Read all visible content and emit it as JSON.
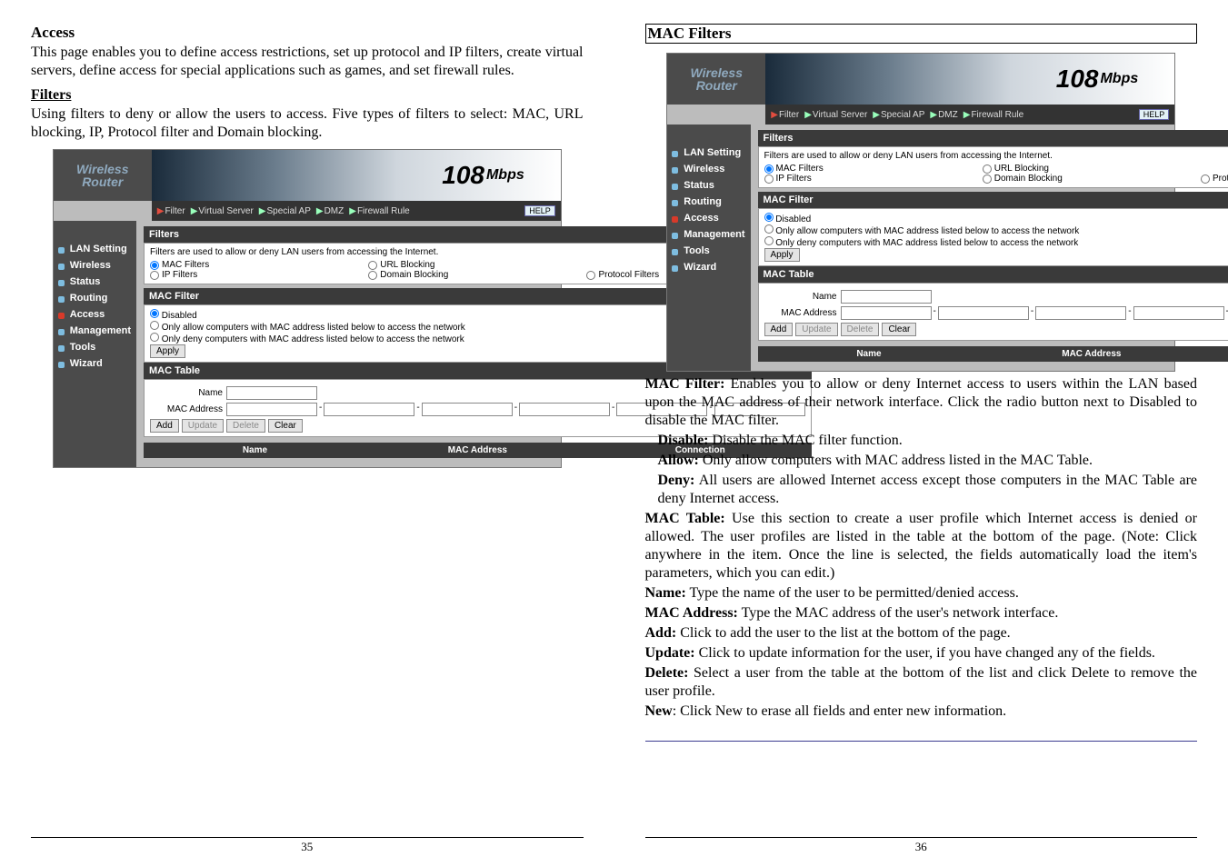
{
  "left": {
    "heading_access": "Access",
    "access_para": "This page enables you to define access restrictions, set up protocol and IP filters, create virtual servers, define access for special applications such as games, and set firewall rules.",
    "heading_filters": "Filters",
    "filters_para": "Using filters to deny or allow the users to access.  Five types of filters to select: MAC, URL blocking, IP, Protocol filter and Domain blocking.",
    "page_num": "35"
  },
  "right": {
    "heading_mac": "MAC Filters",
    "para_macfilter": " Enables you to allow or deny Internet access to users within the LAN based upon the MAC address of their network interface. Click the radio button next to Disabled to disable the MAC filter.",
    "lbl_macfilter": "MAC Filter:",
    "lbl_disable": "Disable:",
    "para_disable": " Disable the MAC filter function.",
    "lbl_allow": "Allow:",
    "para_allow": " Only allow computers with MAC address listed in the MAC Table.",
    "lbl_deny": "Deny:",
    "para_deny": " All users are allowed Internet access except those computers in the MAC Table are deny Internet access.",
    "lbl_mactable": "MAC Table:",
    "para_mactable": " Use this section to create a user profile which Internet access is denied or allowed.  The user profiles are listed in the table at the bottom of the page.  (Note: Click anywhere in the item. Once the line is selected, the fields automatically load the item's parameters, which you can edit.)",
    "lbl_name": "Name:",
    "para_name": " Type the name of the user to be permitted/denied access.",
    "lbl_macaddr": "MAC Address:",
    "para_macaddr": " Type the MAC address of the user's network interface.",
    "lbl_add": "Add:",
    "para_add": " Click to add the user to the list at the bottom of the page.",
    "lbl_update": "Update:",
    "para_update": " Click to update information for the user, if you have changed any of the fields.",
    "lbl_delete": "Delete:",
    "para_delete": " Select a user from the table at the bottom of the list and click Delete to remove the user profile.",
    "lbl_new": "New",
    "para_new": ": Click New to erase all fields and enter new information.",
    "page_num": "36"
  },
  "router": {
    "logo1": "Wireless",
    "logo2": "Router",
    "brand_num": "108",
    "brand_unit": "Mbps",
    "menu": {
      "filter": "Filter",
      "vserver": "Virtual Server",
      "special": "Special AP",
      "dmz": "DMZ",
      "fw": "Firewall Rule",
      "help": "HELP"
    },
    "side": [
      "LAN Setting",
      "Wireless",
      "Status",
      "Routing",
      "Access",
      "Management",
      "Tools",
      "Wizard"
    ],
    "hdr_filters": "Filters",
    "filters_desc": "Filters are used to allow or deny LAN users from accessing the Internet.",
    "opt_mac": "MAC Filters",
    "opt_url": "URL Blocking",
    "opt_ip": "IP Filters",
    "opt_dom": "Domain Blocking",
    "opt_proto": "Protocol Filters",
    "hdr_macfilter": "MAC Filter",
    "opt_disabled": "Disabled",
    "opt_allow_desc": "Only allow computers with MAC address listed below to access the network",
    "opt_deny_desc": "Only deny computers with MAC address listed below to access the network",
    "btn_apply": "Apply",
    "hdr_mactable": "MAC Table",
    "lbl_name": "Name",
    "lbl_macaddr": "MAC Address",
    "btn_add": "Add",
    "btn_update": "Update",
    "btn_delete": "Delete",
    "btn_clear": "Clear",
    "col_name": "Name",
    "col_mac": "MAC Address",
    "col_conn": "Connection"
  }
}
